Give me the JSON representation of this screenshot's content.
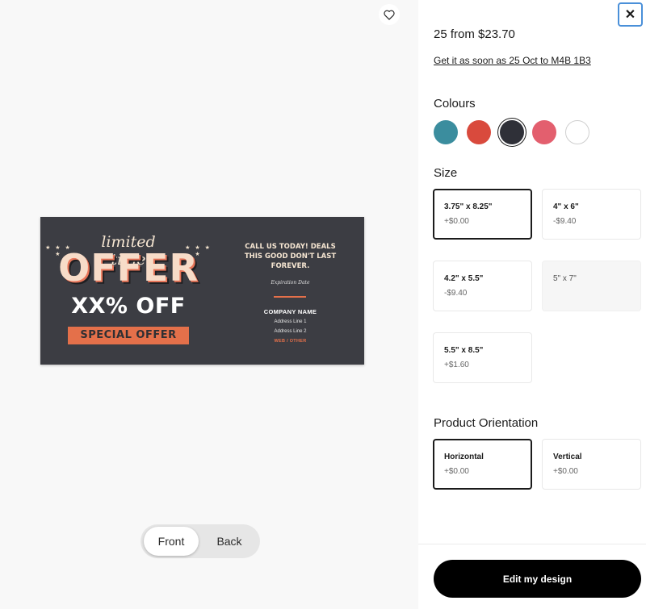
{
  "preview": {
    "favorite_icon": "heart-outline-icon",
    "card": {
      "stars_left": "★ ★ ★ ★",
      "stars_right": "★ ★ ★ ★",
      "limited_time": "limited time",
      "offer": "OFFER",
      "percent_off": "XX% OFF",
      "special_offer": "SPECIAL OFFER",
      "call_line1": "CALL US TODAY! DEALS",
      "call_line2": "THIS GOOD DON'T LAST",
      "call_line3": "FOREVER.",
      "expiration": "Expiration Date",
      "company": "COMPANY NAME",
      "address1": "Address Line 1",
      "address2": "Address Line 2",
      "web": "WEB / OTHER",
      "colors": {
        "background": "#3c3d43",
        "accent": "#e4704a",
        "cream": "#f6e6d2"
      }
    },
    "side_toggle": {
      "front_label": "Front",
      "back_label": "Back",
      "selected": "Front"
    }
  },
  "panel": {
    "close_icon": "close-icon",
    "price": "25 from $23.70",
    "delivery": "Get it as soon as 25 Oct to M4B 1B3",
    "colours": {
      "heading": "Colours",
      "swatches": [
        {
          "name": "teal",
          "hex": "#3b8d9e",
          "selected": false
        },
        {
          "name": "red",
          "hex": "#d94a3d",
          "selected": false
        },
        {
          "name": "charcoal",
          "hex": "#2f3038",
          "selected": true
        },
        {
          "name": "pink",
          "hex": "#e35f6e",
          "selected": false
        },
        {
          "name": "white",
          "hex": "#ffffff",
          "selected": false
        }
      ]
    },
    "size": {
      "heading": "Size",
      "options": [
        {
          "label": "3.75\" x 8.25\"",
          "price": "+$0.00",
          "state": "selected"
        },
        {
          "label": "4\" x 6\"",
          "price": "-$9.40",
          "state": "available"
        },
        {
          "label": "4.2\" x 5.5\"",
          "price": "-$9.40",
          "state": "available"
        },
        {
          "label": "5\" x 7\"",
          "price": "",
          "state": "disabled"
        },
        {
          "label": "5.5\" x 8.5\"",
          "price": "+$1.60",
          "state": "available"
        }
      ]
    },
    "orientation": {
      "heading": "Product Orientation",
      "options": [
        {
          "label": "Horizontal",
          "price": "+$0.00",
          "state": "selected"
        },
        {
          "label": "Vertical",
          "price": "+$0.00",
          "state": "available"
        }
      ]
    },
    "cta_label": "Edit my design"
  }
}
